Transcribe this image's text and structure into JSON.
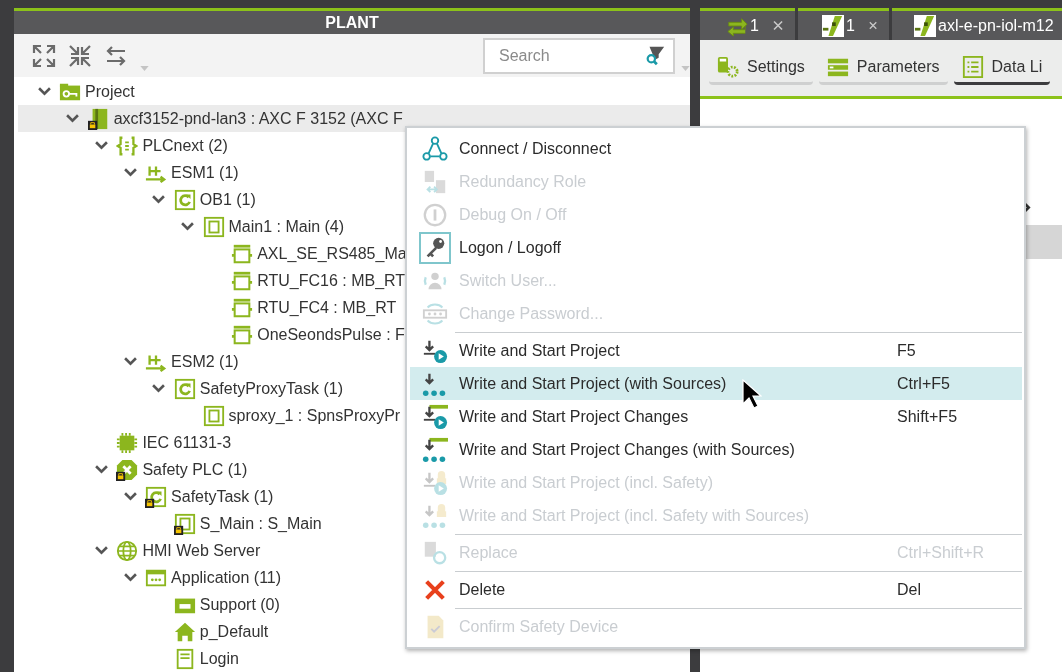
{
  "plant": {
    "title": "PLANT",
    "search": {
      "placeholder": "Search"
    },
    "tree": [
      {
        "label": "Project",
        "kind": "project",
        "expanded": true,
        "selected": false,
        "locked": false,
        "children": [
          {
            "label": "axcf3152-pnd-lan3 : AXC F 3152 (AXC F",
            "kind": "controller",
            "expanded": true,
            "selected": true,
            "locked": true,
            "children": [
              {
                "label": "PLCnext (2)",
                "kind": "plcnext",
                "expanded": true,
                "selected": false,
                "locked": false,
                "children": [
                  {
                    "label": "ESM1 (1)",
                    "kind": "esm",
                    "expanded": true,
                    "selected": false,
                    "locked": false,
                    "children": [
                      {
                        "label": "OB1 (1)",
                        "kind": "task",
                        "expanded": true,
                        "selected": false,
                        "locked": false,
                        "children": [
                          {
                            "label": "Main1 : Main (4)",
                            "kind": "program",
                            "expanded": true,
                            "selected": false,
                            "locked": false,
                            "children": [
                              {
                                "label": "AXL_SE_RS485_Ma",
                                "kind": "instance",
                                "selected": false,
                                "locked": false
                              },
                              {
                                "label": "RTU_FC16 : MB_RT",
                                "kind": "instance",
                                "selected": false,
                                "locked": false
                              },
                              {
                                "label": "RTU_FC4 : MB_RT",
                                "kind": "instance",
                                "selected": false,
                                "locked": false
                              },
                              {
                                "label": "OneSeondsPulse : F",
                                "kind": "instance",
                                "selected": false,
                                "locked": false
                              }
                            ]
                          }
                        ]
                      }
                    ]
                  },
                  {
                    "label": "ESM2 (1)",
                    "kind": "esm",
                    "expanded": true,
                    "selected": false,
                    "locked": false,
                    "children": [
                      {
                        "label": "SafetyProxyTask (1)",
                        "kind": "task",
                        "expanded": true,
                        "selected": false,
                        "locked": false,
                        "children": [
                          {
                            "label": "sproxy_1 : SpnsProxyPr",
                            "kind": "program",
                            "selected": false,
                            "locked": false
                          }
                        ]
                      }
                    ]
                  }
                ]
              },
              {
                "label": "IEC 61131-3",
                "kind": "iec",
                "selected": false,
                "locked": false
              },
              {
                "label": "Safety PLC (1)",
                "kind": "safety",
                "expanded": true,
                "selected": false,
                "locked": true,
                "children": [
                  {
                    "label": "SafetyTask (1)",
                    "kind": "task",
                    "expanded": true,
                    "selected": false,
                    "locked": true,
                    "children": [
                      {
                        "label": "S_Main : S_Main",
                        "kind": "program",
                        "selected": false,
                        "locked": true
                      }
                    ]
                  }
                ]
              },
              {
                "label": "HMI Web Server",
                "kind": "web",
                "expanded": true,
                "selected": false,
                "locked": false,
                "children": [
                  {
                    "label": "Application (11)",
                    "kind": "application",
                    "expanded": true,
                    "selected": false,
                    "locked": false,
                    "children": [
                      {
                        "label": "Support (0)",
                        "kind": "folder",
                        "selected": false,
                        "locked": false
                      },
                      {
                        "label": "p_Default",
                        "kind": "home",
                        "selected": false,
                        "locked": false
                      },
                      {
                        "label": "Login",
                        "kind": "page",
                        "selected": false,
                        "locked": false
                      }
                    ]
                  }
                ]
              }
            ]
          }
        ]
      }
    ]
  },
  "editor": {
    "tabs": [
      {
        "label": "1",
        "kind": "transfer",
        "closable": true,
        "selected": false
      },
      {
        "label": "1",
        "kind": "device",
        "closable": true,
        "selected": false
      },
      {
        "label": "axl-e-pn-iol-m12",
        "kind": "device",
        "selected": false
      }
    ],
    "subtabs": [
      {
        "label": "Settings",
        "kind": "settings",
        "selected": false
      },
      {
        "label": "Parameters",
        "kind": "parameters",
        "selected": false
      },
      {
        "label": "Data Li",
        "kind": "list",
        "selected": true
      }
    ]
  },
  "context_menu": {
    "groups": [
      [
        {
          "label": "Connect / Disconnect",
          "kind": "connect",
          "disabled": false,
          "selected": false
        },
        {
          "label": "Redundancy Role",
          "kind": "redundancy",
          "disabled": true,
          "selected": false
        },
        {
          "label": "Debug On / Off",
          "kind": "debug",
          "disabled": true,
          "selected": false
        },
        {
          "label": "Logon / Logoff",
          "kind": "key",
          "disabled": false,
          "selected": false
        },
        {
          "label": "Switch User...",
          "kind": "user",
          "disabled": true,
          "selected": false
        },
        {
          "label": "Change Password...",
          "kind": "password",
          "disabled": true,
          "selected": false
        }
      ],
      [
        {
          "label": "Write and Start Project",
          "shortcut": "F5",
          "kind": "write",
          "disabled": false,
          "selected": false
        },
        {
          "label": "Write and Start Project (with Sources)",
          "shortcut": "Ctrl+F5",
          "kind": "write-sources",
          "disabled": false,
          "selected": true
        },
        {
          "label": "Write and Start Project Changes",
          "shortcut": "Shift+F5",
          "kind": "changes",
          "disabled": false,
          "selected": false
        },
        {
          "label": "Write and Start Project Changes (with Sources)",
          "kind": "changes-sources",
          "disabled": false,
          "selected": false
        },
        {
          "label": "Write and Start Project (incl. Safety)",
          "kind": "safety-write",
          "disabled": true,
          "selected": false
        },
        {
          "label": "Write and Start Project (incl. Safety with Sources)",
          "kind": "safety-sources",
          "disabled": true,
          "selected": false
        }
      ],
      [
        {
          "label": "Replace",
          "shortcut": "Ctrl+Shift+R",
          "kind": "replace",
          "disabled": true,
          "selected": false
        }
      ],
      [
        {
          "label": "Delete",
          "shortcut": "Del",
          "kind": "delete",
          "disabled": false,
          "selected": false
        }
      ],
      [
        {
          "label": "Confirm Safety Device",
          "kind": "confirm",
          "disabled": true,
          "selected": false
        }
      ]
    ]
  }
}
